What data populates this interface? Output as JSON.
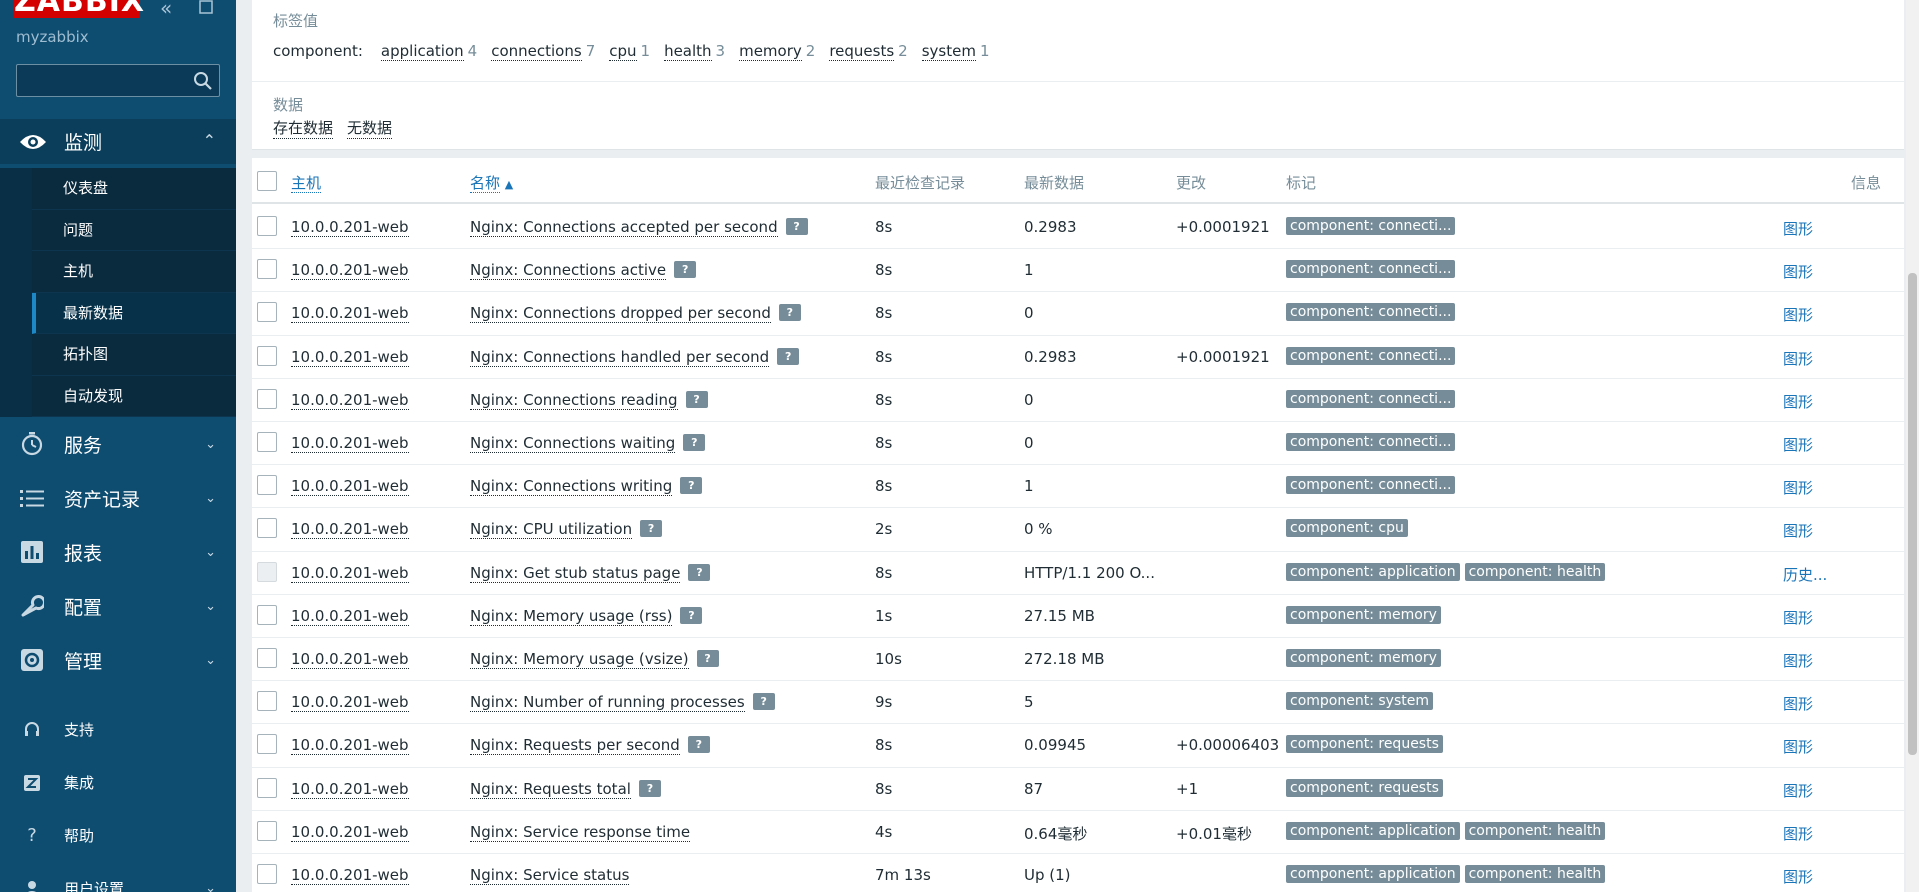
{
  "brand": {
    "logo": "ZABBIX",
    "server_name": "myzabbix",
    "color": "#d40000"
  },
  "sidebar": {
    "search_placeholder": "",
    "monitoring": {
      "label": "监测",
      "items": [
        "仪表盘",
        "问题",
        "主机",
        "最新数据",
        "拓扑图",
        "自动发现"
      ],
      "active": "最新数据"
    },
    "menus": [
      {
        "label": "服务",
        "icon": "clock-icon"
      },
      {
        "label": "资产记录",
        "icon": "list-icon"
      },
      {
        "label": "报表",
        "icon": "bar-chart-icon"
      },
      {
        "label": "配置",
        "icon": "wrench-icon"
      },
      {
        "label": "管理",
        "icon": "gear-icon"
      }
    ],
    "bottom": [
      {
        "label": "支持",
        "icon": "headset-icon"
      },
      {
        "label": "集成",
        "icon": "zabbix-z-icon"
      },
      {
        "label": "帮助",
        "icon": "question-icon"
      },
      {
        "label": "用户设置",
        "icon": "user-icon"
      }
    ]
  },
  "filter": {
    "tag_values_title": "标签值",
    "tag_key": "component:",
    "tag_values": [
      {
        "name": "application",
        "count": "4"
      },
      {
        "name": "connections",
        "count": "7"
      },
      {
        "name": "cpu",
        "count": "1"
      },
      {
        "name": "health",
        "count": "3"
      },
      {
        "name": "memory",
        "count": "2"
      },
      {
        "name": "requests",
        "count": "2"
      },
      {
        "name": "system",
        "count": "1"
      }
    ],
    "data_title": "数据",
    "data_options": [
      "存在数据",
      "无数据"
    ]
  },
  "table": {
    "headers": {
      "host": "主机",
      "name": "名称",
      "last_check": "最近检查记录",
      "last_value": "最新数据",
      "change": "更改",
      "tags": "标记",
      "info": "信息"
    },
    "sort_indicator": "▲",
    "rows": [
      {
        "host": "10.0.0.201-web",
        "name": "Nginx: Connections accepted per second",
        "hint": true,
        "last_check": "8s",
        "last_value": "0.2983",
        "change": "+0.0001921",
        "tags": [
          "component: connecti..."
        ],
        "action": "图形"
      },
      {
        "host": "10.0.0.201-web",
        "name": "Nginx: Connections active",
        "hint": true,
        "last_check": "8s",
        "last_value": "1",
        "change": "",
        "tags": [
          "component: connecti..."
        ],
        "action": "图形"
      },
      {
        "host": "10.0.0.201-web",
        "name": "Nginx: Connections dropped per second",
        "hint": true,
        "last_check": "8s",
        "last_value": "0",
        "change": "",
        "tags": [
          "component: connecti..."
        ],
        "action": "图形"
      },
      {
        "host": "10.0.0.201-web",
        "name": "Nginx: Connections handled per second",
        "hint": true,
        "last_check": "8s",
        "last_value": "0.2983",
        "change": "+0.0001921",
        "tags": [
          "component: connecti..."
        ],
        "action": "图形"
      },
      {
        "host": "10.0.0.201-web",
        "name": "Nginx: Connections reading",
        "hint": true,
        "last_check": "8s",
        "last_value": "0",
        "change": "",
        "tags": [
          "component: connecti..."
        ],
        "action": "图形"
      },
      {
        "host": "10.0.0.201-web",
        "name": "Nginx: Connections waiting",
        "hint": true,
        "last_check": "8s",
        "last_value": "0",
        "change": "",
        "tags": [
          "component: connecti..."
        ],
        "action": "图形"
      },
      {
        "host": "10.0.0.201-web",
        "name": "Nginx: Connections writing",
        "hint": true,
        "last_check": "8s",
        "last_value": "1",
        "change": "",
        "tags": [
          "component: connecti..."
        ],
        "action": "图形"
      },
      {
        "host": "10.0.0.201-web",
        "name": "Nginx: CPU utilization",
        "hint": true,
        "last_check": "2s",
        "last_value": "0 %",
        "change": "",
        "tags": [
          "component: cpu"
        ],
        "action": "图形"
      },
      {
        "host": "10.0.0.201-web",
        "name": "Nginx: Get stub status page",
        "hint": true,
        "last_check": "8s",
        "last_value": "HTTP/1.1 200 O...",
        "change": "",
        "tags": [
          "component: application",
          "component: health"
        ],
        "action": "历史...",
        "disabled": true
      },
      {
        "host": "10.0.0.201-web",
        "name": "Nginx: Memory usage (rss)",
        "hint": true,
        "last_check": "1s",
        "last_value": "27.15 MB",
        "change": "",
        "tags": [
          "component: memory"
        ],
        "action": "图形"
      },
      {
        "host": "10.0.0.201-web",
        "name": "Nginx: Memory usage (vsize)",
        "hint": true,
        "last_check": "10s",
        "last_value": "272.18 MB",
        "change": "",
        "tags": [
          "component: memory"
        ],
        "action": "图形"
      },
      {
        "host": "10.0.0.201-web",
        "name": "Nginx: Number of running processes",
        "hint": true,
        "last_check": "9s",
        "last_value": "5",
        "change": "",
        "tags": [
          "component: system"
        ],
        "action": "图形"
      },
      {
        "host": "10.0.0.201-web",
        "name": "Nginx: Requests per second",
        "hint": true,
        "last_check": "8s",
        "last_value": "0.09945",
        "change": "+0.00006403",
        "tags": [
          "component: requests"
        ],
        "action": "图形"
      },
      {
        "host": "10.0.0.201-web",
        "name": "Nginx: Requests total",
        "hint": true,
        "last_check": "8s",
        "last_value": "87",
        "change": "+1",
        "tags": [
          "component: requests"
        ],
        "action": "图形"
      },
      {
        "host": "10.0.0.201-web",
        "name": "Nginx: Service response time",
        "hint": false,
        "last_check": "4s",
        "last_value": "0.64毫秒",
        "change": "+0.01毫秒",
        "tags": [
          "component: application",
          "component: health"
        ],
        "action": "图形"
      },
      {
        "host": "10.0.0.201-web",
        "name": "Nginx: Service status",
        "hint": false,
        "last_check": "7m 13s",
        "last_value": "Up (1)",
        "change": "",
        "tags": [
          "component: application",
          "component: health"
        ],
        "action": "图形"
      }
    ]
  }
}
